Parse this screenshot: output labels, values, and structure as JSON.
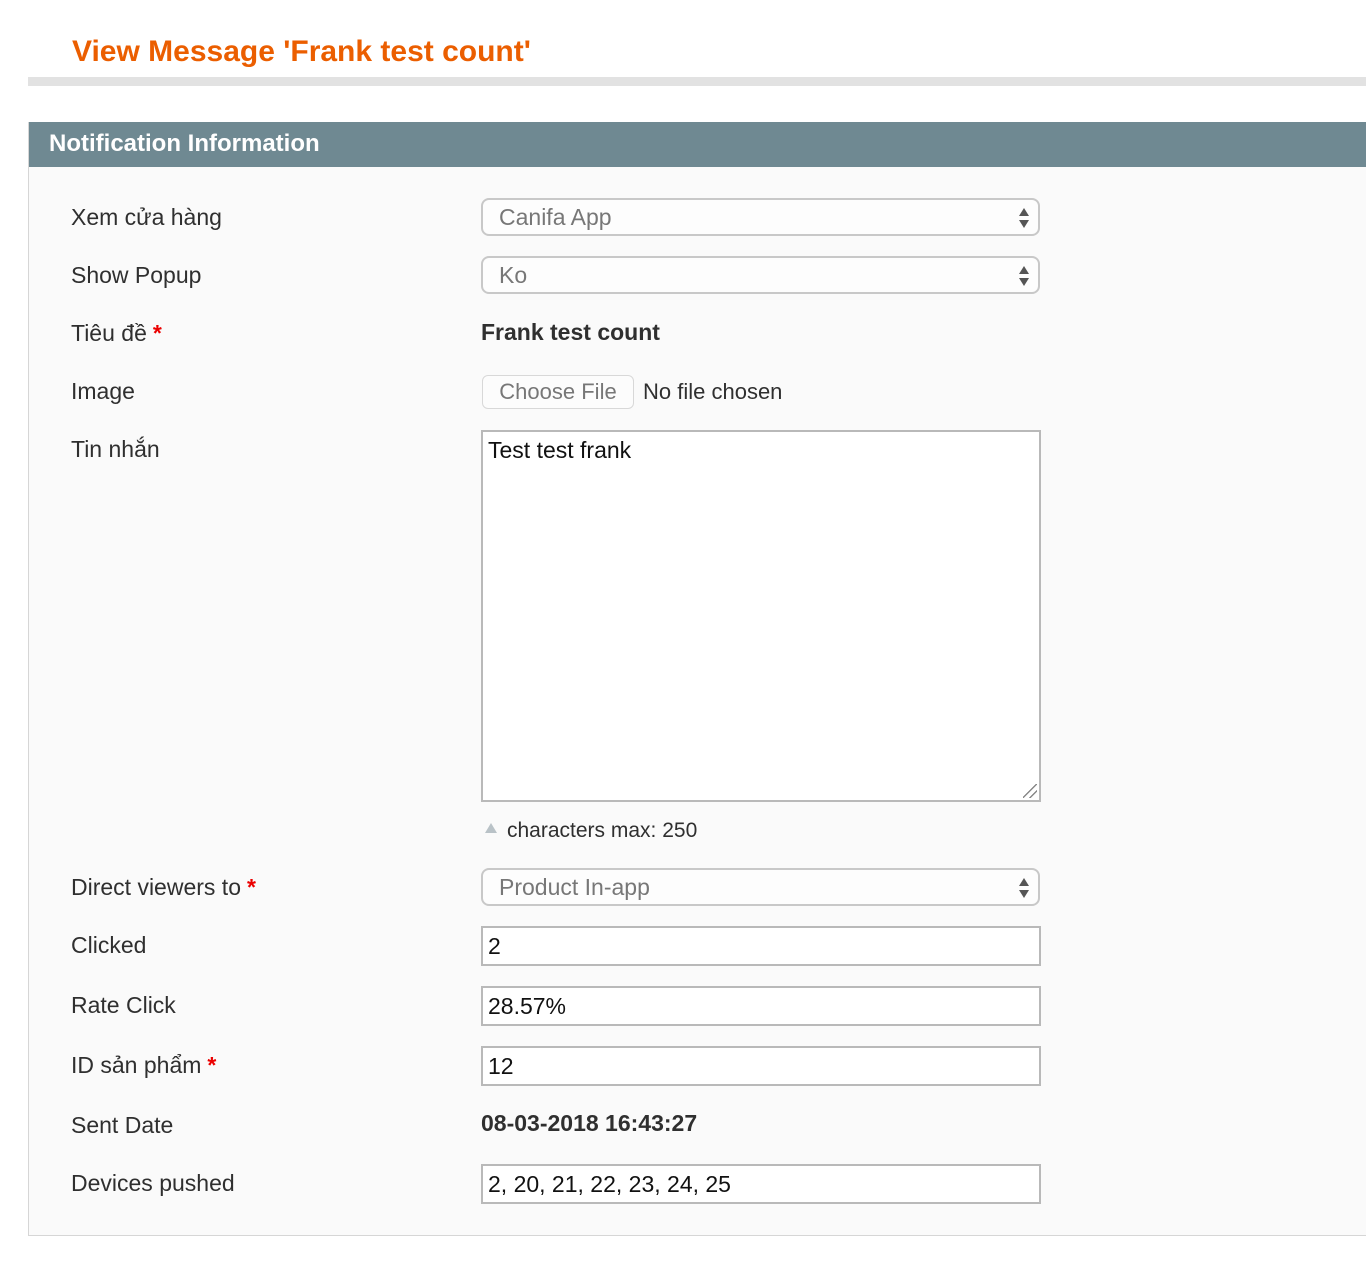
{
  "page": {
    "title": "View Message 'Frank test count'"
  },
  "panel": {
    "title": "Notification Information",
    "fields": {
      "store_view": {
        "label": "Xem cửa hàng",
        "value": "Canifa App"
      },
      "show_popup": {
        "label": "Show Popup",
        "value": "Ko"
      },
      "title": {
        "label": "Tiêu đề",
        "required": "*",
        "value": "Frank test count"
      },
      "image": {
        "label": "Image",
        "button": "Choose File",
        "status": "No file chosen"
      },
      "message": {
        "label": "Tin nhắn",
        "value": "Test test frank",
        "hint": "characters max: 250"
      },
      "direct_viewers": {
        "label": "Direct viewers to",
        "required": "*",
        "value": "Product In-app"
      },
      "clicked": {
        "label": "Clicked",
        "value": "2"
      },
      "rate_click": {
        "label": "Rate Click",
        "value": "28.57%"
      },
      "product_id": {
        "label": "ID sản phẩm",
        "required": "*",
        "value": "12"
      },
      "sent_date": {
        "label": "Sent Date",
        "value": "08-03-2018 16:43:27"
      },
      "devices_pushed": {
        "label": "Devices pushed",
        "value": "2, 20, 21, 22, 23, 24, 25"
      }
    }
  },
  "colors": {
    "title": "#eb5e00",
    "panel_header": "#6f8992",
    "required": "#eb0000"
  }
}
